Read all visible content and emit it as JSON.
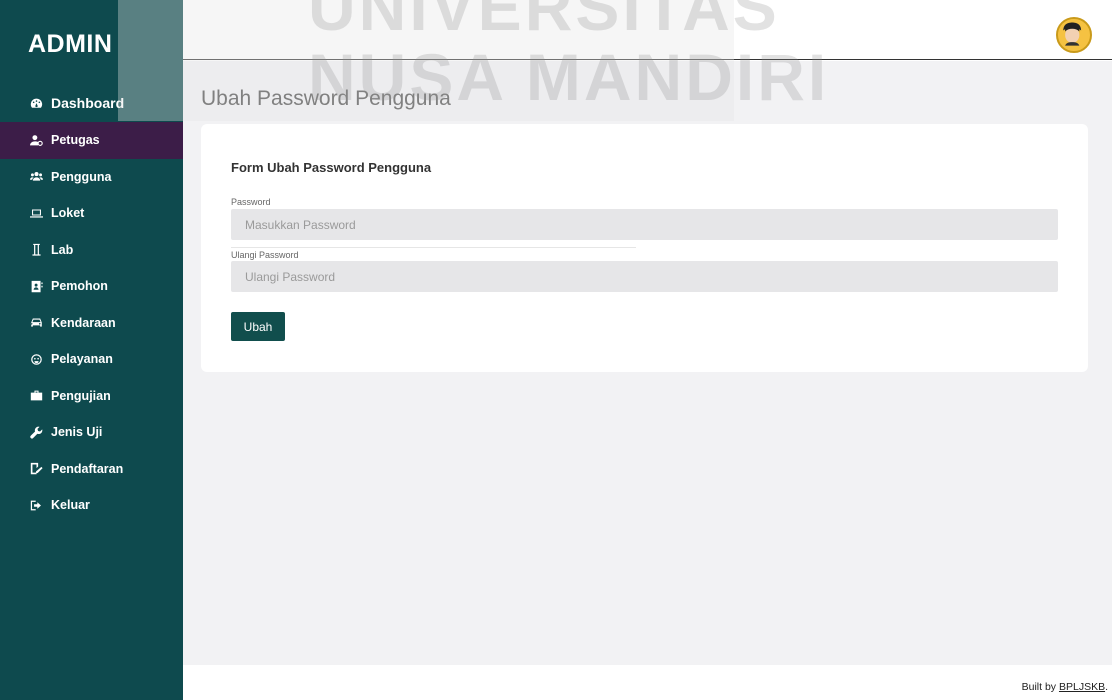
{
  "sidebar": {
    "brand": "ADMIN",
    "items": [
      {
        "label": "Dashboard",
        "icon": "dashboard-icon"
      },
      {
        "label": "Petugas",
        "icon": "user-cog-icon"
      },
      {
        "label": "Pengguna",
        "icon": "users-icon"
      },
      {
        "label": "Loket",
        "icon": "laptop-icon"
      },
      {
        "label": "Lab",
        "icon": "flask-icon"
      },
      {
        "label": "Pemohon",
        "icon": "address-book-icon"
      },
      {
        "label": "Kendaraan",
        "icon": "car-icon"
      },
      {
        "label": "Pelayanan",
        "icon": "headset-icon"
      },
      {
        "label": "Pengujian",
        "icon": "toolbox-icon"
      },
      {
        "label": "Jenis Uji",
        "icon": "wrench-icon"
      },
      {
        "label": "Pendaftaran",
        "icon": "file-signature-icon"
      },
      {
        "label": "Keluar",
        "icon": "sign-out-icon"
      }
    ],
    "active_index": 1
  },
  "watermark": {
    "line1": "UNIVERSITAS",
    "line2": "NUSA MANDIRI"
  },
  "main": {
    "page_title": "Ubah Password Pengguna",
    "form": {
      "title": "Form Ubah Password Pengguna",
      "password_label": "Password",
      "password_placeholder": "Masukkan Password",
      "repeat_label": "Ulangi Password",
      "repeat_placeholder": "Ulangi Password",
      "submit_label": "Ubah"
    }
  },
  "footer": {
    "prefix": "Built by ",
    "link": "BPLJSKB",
    "suffix": "."
  },
  "colors": {
    "sidebar": "#0e4a4e",
    "active": "#3c1d48",
    "button": "#114e4d",
    "content_bg": "#f2f2f4"
  }
}
